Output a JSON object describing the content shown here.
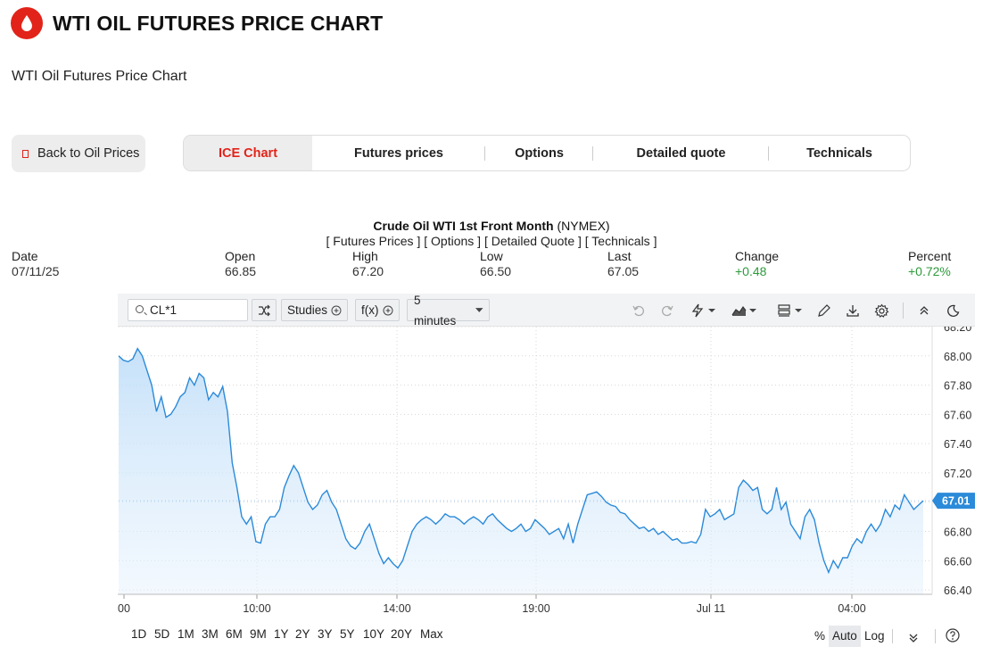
{
  "header": {
    "logo_icon": "oil-drop-icon",
    "title": "WTI OIL FUTURES PRICE CHART",
    "subtitle": "WTI Oil Futures Price Chart",
    "brand_color": "#e2231a"
  },
  "back_button": {
    "label": "Back to Oil Prices"
  },
  "tabs": [
    {
      "label": "ICE Chart",
      "active": true
    },
    {
      "label": "Futures prices",
      "active": false
    },
    {
      "label": "Options",
      "active": false
    },
    {
      "label": "Detailed quote",
      "active": false
    },
    {
      "label": "Technicals",
      "active": false
    }
  ],
  "quote": {
    "name": "Crude Oil WTI 1st Front Month",
    "exchange": "(NYMEX)",
    "links": [
      "[ Futures Prices ]",
      "[ Options ]",
      "[ Detailed Quote ]",
      "[ Technicals ]"
    ]
  },
  "stats": {
    "date": {
      "label": "Date",
      "value": "07/11/25"
    },
    "open": {
      "label": "Open",
      "value": "66.85"
    },
    "high": {
      "label": "High",
      "value": "67.20"
    },
    "low": {
      "label": "Low",
      "value": "66.50"
    },
    "last": {
      "label": "Last",
      "value": "67.05"
    },
    "change": {
      "label": "Change",
      "value": "+0.48"
    },
    "percent": {
      "label": "Percent",
      "value": "+0.72%"
    }
  },
  "toolbar": {
    "symbol": "CL*1",
    "studies_label": "Studies",
    "fx_label": "f(x)",
    "interval_label": "5 minutes",
    "icons": [
      "compare-icon",
      "undo-icon",
      "redo-icon",
      "lightning-icon",
      "chart-type-icon",
      "layout-icon",
      "pencil-icon",
      "download-icon",
      "settings-icon",
      "collapse-icon",
      "dark-mode-icon"
    ]
  },
  "bottom_bar": {
    "ranges": [
      "1D",
      "5D",
      "1M",
      "3M",
      "6M",
      "9M",
      "1Y",
      "2Y",
      "3Y",
      "5Y",
      "10Y",
      "20Y",
      "Max"
    ],
    "percent_label": "%",
    "auto_label": "Auto",
    "log_label": "Log"
  },
  "chart_data": {
    "type": "area",
    "line_color": "#2b8ad9",
    "x_tick_labels": [
      "00",
      "10:00",
      "14:00",
      "19:00",
      "Jul 11",
      "04:00"
    ],
    "y_tick_labels": [
      "68.20",
      "68.00",
      "67.80",
      "67.60",
      "67.40",
      "67.20",
      "67.00",
      "66.80",
      "66.60",
      "66.40"
    ],
    "ylim": [
      66.37,
      68.2
    ],
    "last_price_label": "67.01",
    "grid": true,
    "values": [
      68.0,
      67.97,
      67.96,
      67.98,
      68.05,
      68.0,
      67.9,
      67.8,
      67.62,
      67.72,
      67.58,
      67.6,
      67.65,
      67.72,
      67.75,
      67.85,
      67.8,
      67.88,
      67.85,
      67.7,
      67.75,
      67.72,
      67.79,
      67.62,
      67.27,
      67.1,
      66.9,
      66.85,
      66.9,
      66.73,
      66.72,
      66.85,
      66.9,
      66.9,
      66.95,
      67.1,
      67.18,
      67.25,
      67.2,
      67.1,
      67.0,
      66.95,
      66.98,
      67.05,
      67.08,
      67.0,
      66.95,
      66.85,
      66.75,
      66.7,
      66.68,
      66.72,
      66.8,
      66.85,
      66.75,
      66.65,
      66.58,
      66.62,
      66.58,
      66.55,
      66.6,
      66.7,
      66.8,
      66.85,
      66.88,
      66.9,
      66.88,
      66.85,
      66.88,
      66.92,
      66.9,
      66.9,
      66.88,
      66.85,
      66.88,
      66.9,
      66.88,
      66.85,
      66.9,
      66.92,
      66.88,
      66.85,
      66.82,
      66.8,
      66.82,
      66.85,
      66.8,
      66.82,
      66.88,
      66.85,
      66.82,
      66.78,
      66.8,
      66.82,
      66.75,
      66.85,
      66.72,
      66.85,
      66.95,
      67.05,
      67.06,
      67.07,
      67.04,
      67.0,
      66.98,
      66.97,
      66.93,
      66.92,
      66.88,
      66.85,
      66.82,
      66.83,
      66.8,
      66.82,
      66.78,
      66.8,
      66.77,
      66.74,
      66.75,
      66.72,
      66.72,
      66.73,
      66.72,
      66.78,
      66.95,
      66.9,
      66.92,
      66.95,
      66.88,
      66.9,
      66.92,
      67.1,
      67.15,
      67.12,
      67.08,
      67.1,
      66.95,
      66.92,
      66.95,
      67.1,
      66.95,
      67.0,
      66.85,
      66.8,
      66.75,
      66.9,
      66.95,
      66.88,
      66.72,
      66.6,
      66.52,
      66.6,
      66.55,
      66.62,
      66.62,
      66.7,
      66.75,
      66.72,
      66.8,
      66.85,
      66.8,
      66.85,
      66.95,
      66.9,
      66.98,
      66.95,
      67.05,
      67.0,
      66.95,
      66.98,
      67.01
    ]
  }
}
